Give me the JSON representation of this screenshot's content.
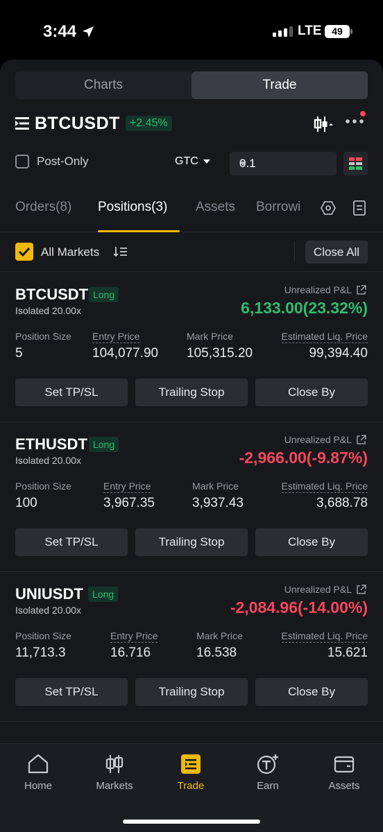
{
  "status_bar": {
    "time": "3:44",
    "network": "LTE",
    "battery": "49"
  },
  "segment": {
    "charts": "Charts",
    "trade": "Trade",
    "selected": "Trade"
  },
  "symbol": {
    "name": "BTCUSDT",
    "change": "+2.45%"
  },
  "options": {
    "post_only_label": "Post-Only",
    "post_only_checked": false,
    "time_in_force": "GTC",
    "quantity": "0.1"
  },
  "tabs": {
    "orders": "Orders(8)",
    "positions": "Positions(3)",
    "assets": "Assets",
    "borrow": "Borrowi",
    "active": "positions"
  },
  "filter": {
    "all_markets_label": "All Markets",
    "all_markets_checked": true,
    "close_all": "Close All"
  },
  "labels": {
    "unrealized_pnl": "Unrealized P&L",
    "position_size": "Position Size",
    "entry_price": "Entry Price",
    "mark_price": "Mark Price",
    "est_liq_price": "Estimated Liq. Price",
    "set_tpsl": "Set TP/SL",
    "trailing_stop": "Trailing Stop",
    "close_by": "Close By"
  },
  "positions": [
    {
      "symbol": "BTCUSDT",
      "side": "Long",
      "margin": "Isolated 20.00x",
      "pnl": "6,133.00(23.32%)",
      "pnl_color": "#2ebd6e",
      "size": "5",
      "entry": "104,077.90",
      "mark": "105,315.20",
      "liq": "99,394.40"
    },
    {
      "symbol": "ETHUSDT",
      "side": "Long",
      "margin": "Isolated 20.00x",
      "pnl": "-2,966.00(-9.87%)",
      "pnl_color": "#f6465d",
      "size": "100",
      "entry": "3,967.35",
      "mark": "3,937.43",
      "liq": "3,688.78"
    },
    {
      "symbol": "UNIUSDT",
      "side": "Long",
      "margin": "Isolated 20.00x",
      "pnl": "-2,084.96(-14.00%)",
      "pnl_color": "#f6465d",
      "size": "11,713.3",
      "entry": "16.716",
      "mark": "16.538",
      "liq": "15.621"
    }
  ],
  "nav": {
    "home": "Home",
    "markets": "Markets",
    "trade": "Trade",
    "earn": "Earn",
    "assets": "Assets",
    "active": "trade"
  },
  "colors": {
    "accent": "#f0b90b",
    "up": "#2ebd6e",
    "down": "#f6465d",
    "liq": "#f0a92d"
  }
}
